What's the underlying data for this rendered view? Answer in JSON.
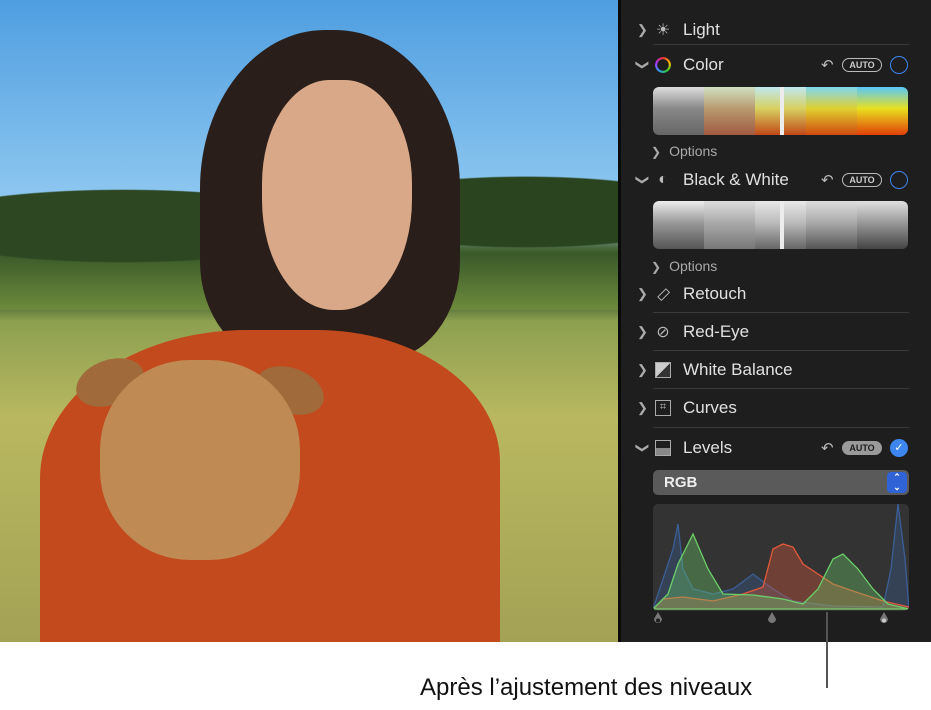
{
  "panel": {
    "sections": [
      {
        "label": "Light",
        "icon": "sun-icon",
        "expanded": false
      },
      {
        "label": "Color",
        "icon": "color-wheel-icon",
        "expanded": true,
        "auto": "AUTO",
        "options": "Options"
      },
      {
        "label": "Black & White",
        "icon": "half-circle-icon",
        "expanded": true,
        "auto": "AUTO",
        "options": "Options"
      },
      {
        "label": "Retouch",
        "icon": "bandage-icon",
        "expanded": false
      },
      {
        "label": "Red-Eye",
        "icon": "eye-slash-icon",
        "expanded": false
      },
      {
        "label": "White Balance",
        "icon": "white-balance-icon",
        "expanded": false
      },
      {
        "label": "Curves",
        "icon": "curves-icon",
        "expanded": false
      },
      {
        "label": "Levels",
        "icon": "levels-icon",
        "expanded": true,
        "auto": "AUTO",
        "enabled": true
      }
    ],
    "levels_channel": "RGB"
  },
  "caption": "Après l’ajustement des niveaux",
  "colors": {
    "accent": "#3d86f0",
    "panel": "#1e1e1e"
  }
}
